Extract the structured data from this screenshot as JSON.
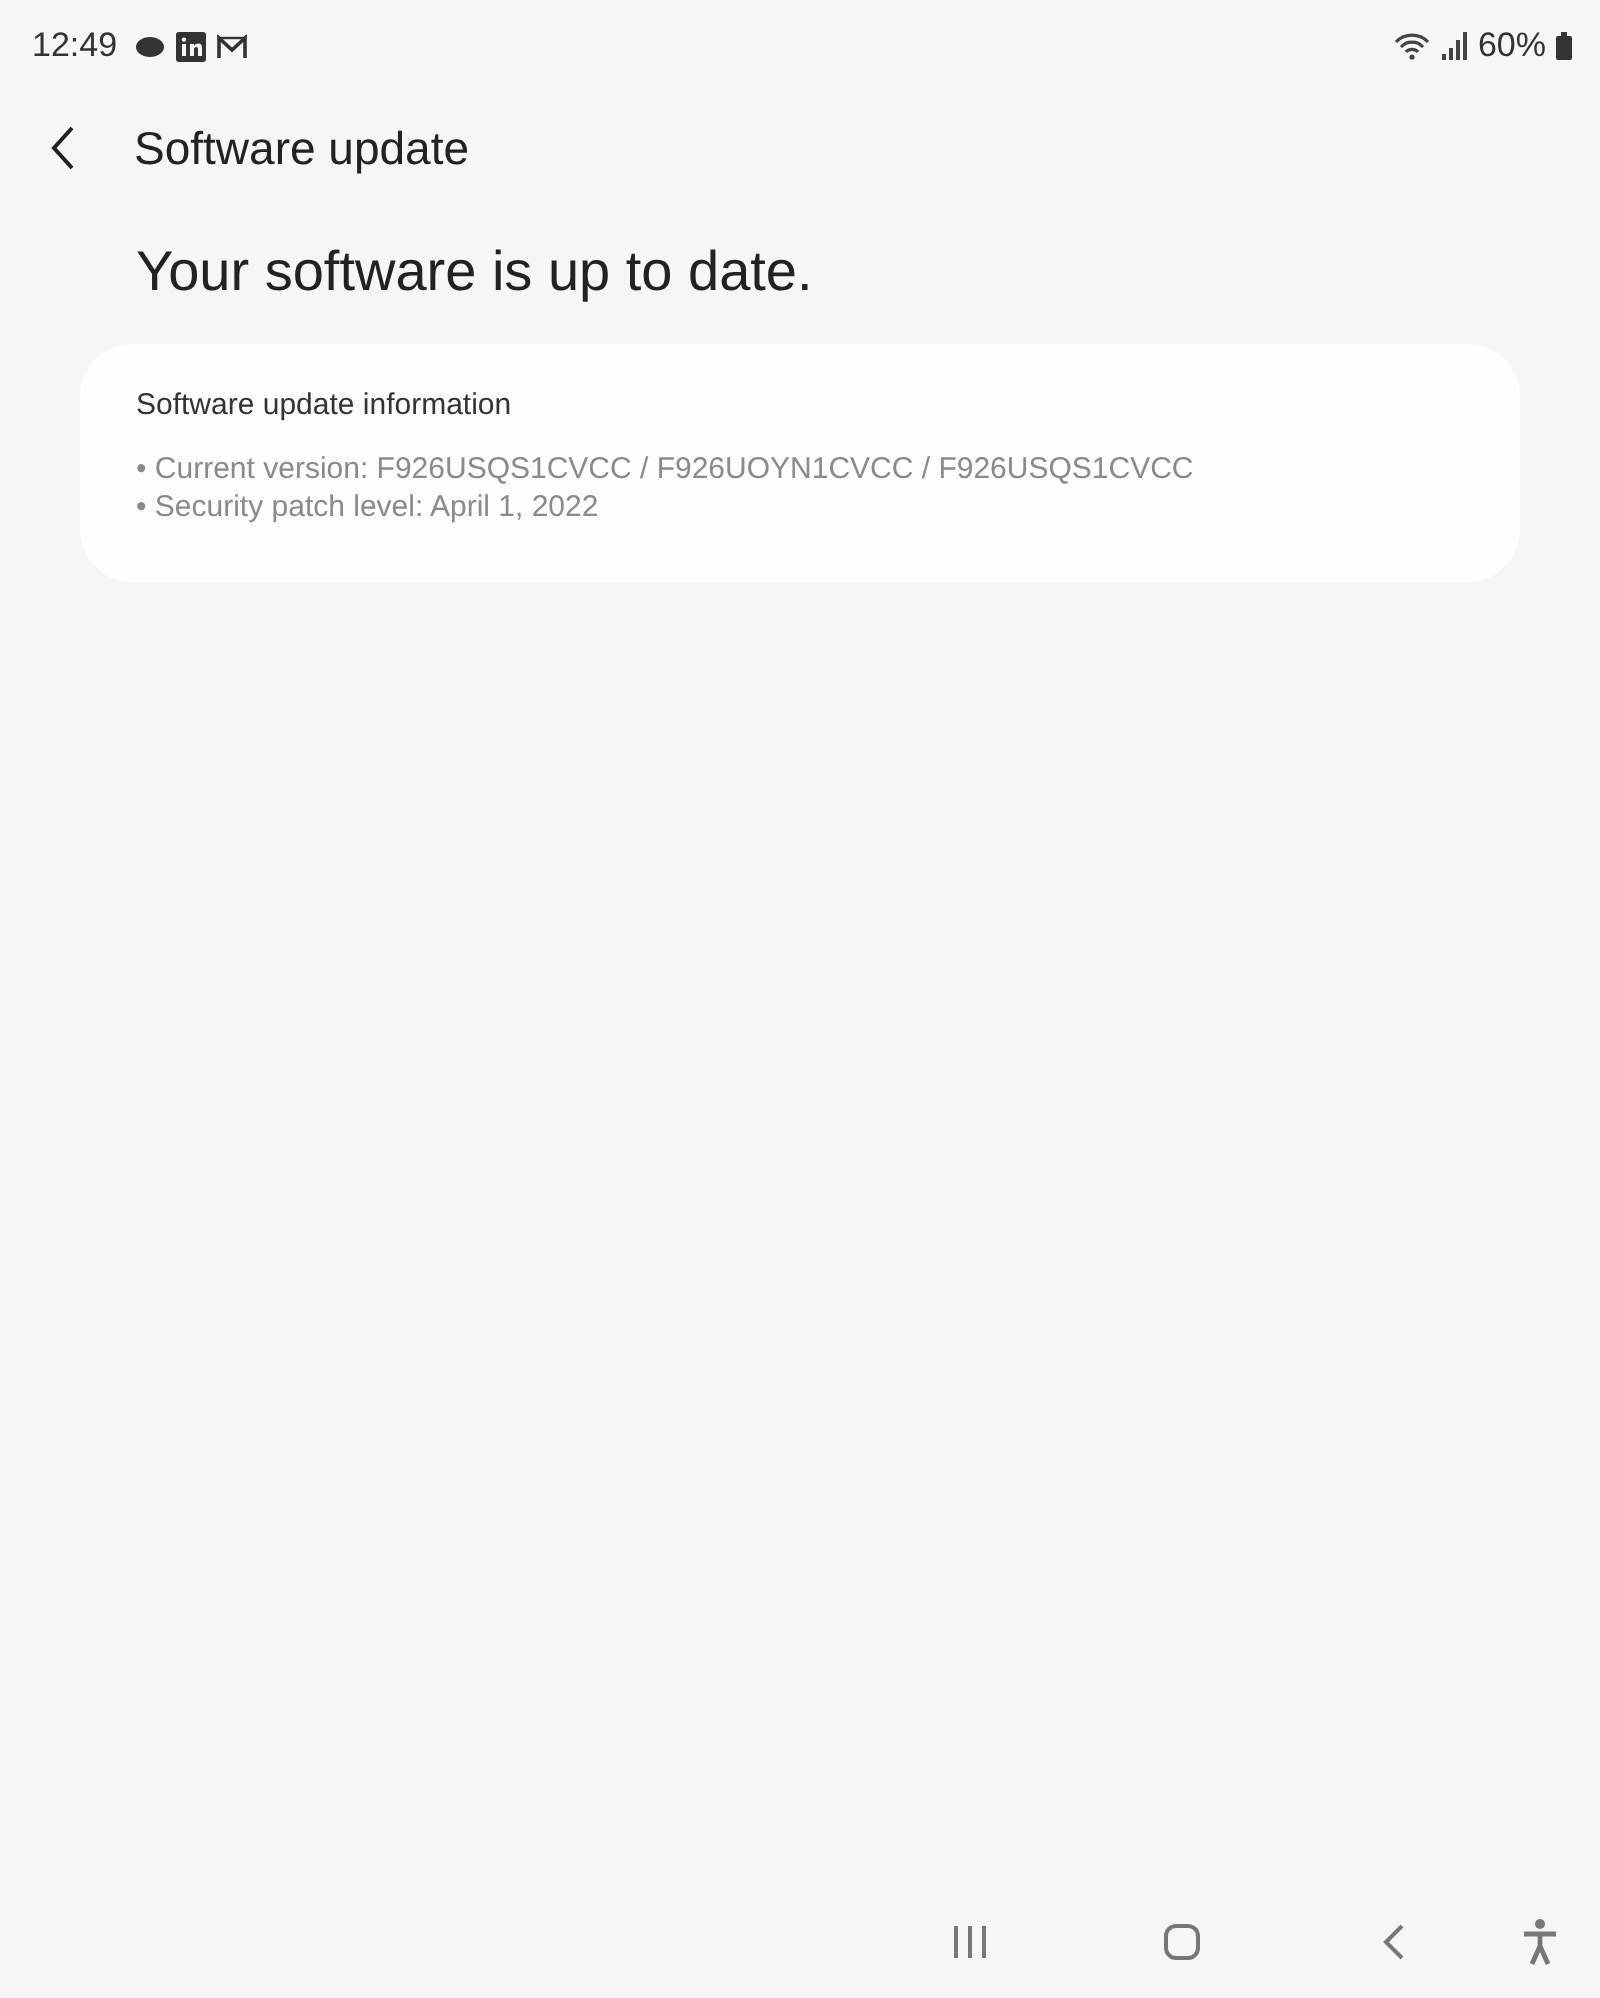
{
  "status_bar": {
    "time": "12:49",
    "battery": "60%"
  },
  "header": {
    "title": "Software update"
  },
  "status_message": "Your software is up to date.",
  "info_card": {
    "title": "Software update information",
    "lines": [
      "• Current version: F926USQS1CVCC / F926UOYN1CVCC / F926USQS1CVCC",
      "• Security patch level: April 1, 2022"
    ]
  }
}
